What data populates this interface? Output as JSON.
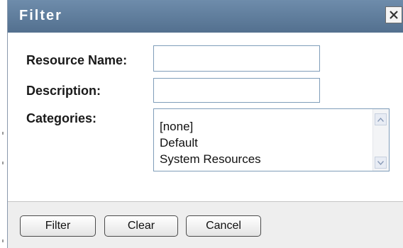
{
  "dialog": {
    "title": "Filter",
    "close_icon": "close-icon"
  },
  "form": {
    "resource_name_label": "Resource Name:",
    "resource_name_value": "",
    "description_label": "Description:",
    "description_value": "",
    "categories_label": "Categories:",
    "categories_options": [
      "[none]",
      "Default",
      "System Resources"
    ]
  },
  "buttons": {
    "filter": "Filter",
    "clear": "Clear",
    "cancel": "Cancel"
  },
  "colors": {
    "titlebar": "#6e8cab",
    "input_border": "#7f9db9",
    "footer_bg": "#eeeeee"
  }
}
